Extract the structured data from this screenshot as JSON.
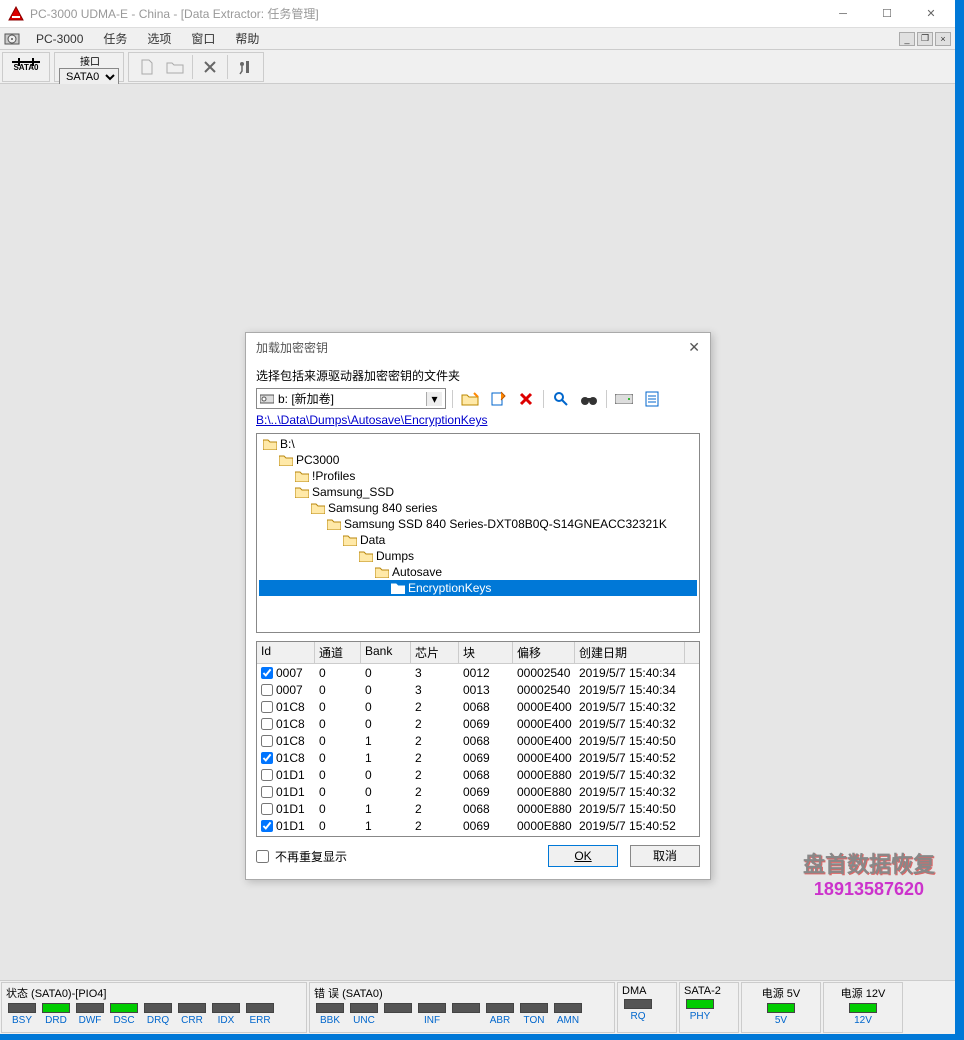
{
  "window": {
    "title": "PC-3000 UDMA-E - China - [Data Extractor: 任务管理]"
  },
  "menu": {
    "app": "PC-3000",
    "items": [
      "任务",
      "选项",
      "窗口",
      "帮助"
    ]
  },
  "toolbar": {
    "sata_label": "SATA0",
    "port_label": "接口",
    "port_value": "SATA0"
  },
  "dialog": {
    "title": "加载加密密钥",
    "instruction": "选择包括来源驱动器加密密钥的文件夹",
    "drive": "b: [新加卷]",
    "path": "B:\\..\\Data\\Dumps\\Autosave\\EncryptionKeys",
    "tree": [
      {
        "indent": 0,
        "label": "B:\\",
        "open": true
      },
      {
        "indent": 1,
        "label": "PC3000",
        "open": true
      },
      {
        "indent": 2,
        "label": "!Profiles",
        "open": false
      },
      {
        "indent": 2,
        "label": "Samsung_SSD",
        "open": true
      },
      {
        "indent": 3,
        "label": "Samsung 840 series",
        "open": true
      },
      {
        "indent": 4,
        "label": "Samsung SSD 840 Series-DXT08B0Q-S14GNEACC32321K",
        "open": true
      },
      {
        "indent": 5,
        "label": "Data",
        "open": true
      },
      {
        "indent": 6,
        "label": "Dumps",
        "open": true
      },
      {
        "indent": 7,
        "label": "Autosave",
        "open": true
      },
      {
        "indent": 8,
        "label": "EncryptionKeys",
        "open": true,
        "selected": true
      }
    ],
    "columns": [
      "Id",
      "通道",
      "Bank",
      "芯片",
      "块",
      "偏移",
      "创建日期"
    ],
    "rows": [
      {
        "checked": true,
        "id": "0007",
        "ch": "0",
        "bank": "0",
        "chip": "3",
        "block": "0012",
        "offset": "00002540",
        "date": "2019/5/7 15:40:34"
      },
      {
        "checked": false,
        "id": "0007",
        "ch": "0",
        "bank": "0",
        "chip": "3",
        "block": "0013",
        "offset": "00002540",
        "date": "2019/5/7 15:40:34"
      },
      {
        "checked": false,
        "id": "01C8",
        "ch": "0",
        "bank": "0",
        "chip": "2",
        "block": "0068",
        "offset": "0000E400",
        "date": "2019/5/7 15:40:32"
      },
      {
        "checked": false,
        "id": "01C8",
        "ch": "0",
        "bank": "0",
        "chip": "2",
        "block": "0069",
        "offset": "0000E400",
        "date": "2019/5/7 15:40:32"
      },
      {
        "checked": false,
        "id": "01C8",
        "ch": "0",
        "bank": "1",
        "chip": "2",
        "block": "0068",
        "offset": "0000E400",
        "date": "2019/5/7 15:40:50"
      },
      {
        "checked": true,
        "id": "01C8",
        "ch": "0",
        "bank": "1",
        "chip": "2",
        "block": "0069",
        "offset": "0000E400",
        "date": "2019/5/7 15:40:52"
      },
      {
        "checked": false,
        "id": "01D1",
        "ch": "0",
        "bank": "0",
        "chip": "2",
        "block": "0068",
        "offset": "0000E880",
        "date": "2019/5/7 15:40:32"
      },
      {
        "checked": false,
        "id": "01D1",
        "ch": "0",
        "bank": "0",
        "chip": "2",
        "block": "0069",
        "offset": "0000E880",
        "date": "2019/5/7 15:40:32"
      },
      {
        "checked": false,
        "id": "01D1",
        "ch": "0",
        "bank": "1",
        "chip": "2",
        "block": "0068",
        "offset": "0000E880",
        "date": "2019/5/7 15:40:50"
      },
      {
        "checked": true,
        "id": "01D1",
        "ch": "0",
        "bank": "1",
        "chip": "2",
        "block": "0069",
        "offset": "0000E880",
        "date": "2019/5/7 15:40:52"
      }
    ],
    "no_repeat": "不再重复显示",
    "ok": "OK",
    "cancel": "取消"
  },
  "watermark": {
    "line1": "盘首数据恢复",
    "line2": "18913587620"
  },
  "status": {
    "state_label": "状态 (SATA0)-[PIO4]",
    "state_leds": [
      {
        "label": "BSY",
        "on": false
      },
      {
        "label": "DRD",
        "on": true
      },
      {
        "label": "DWF",
        "on": false
      },
      {
        "label": "DSC",
        "on": true
      },
      {
        "label": "DRQ",
        "on": false
      },
      {
        "label": "CRR",
        "on": false
      },
      {
        "label": "IDX",
        "on": false
      },
      {
        "label": "ERR",
        "on": false
      }
    ],
    "error_label": "错 误 (SATA0)",
    "error_leds": [
      {
        "label": "BBK",
        "on": false
      },
      {
        "label": "UNC",
        "on": false
      },
      {
        "label": "",
        "on": false
      },
      {
        "label": "INF",
        "on": false
      },
      {
        "label": "",
        "on": false
      },
      {
        "label": "ABR",
        "on": false
      },
      {
        "label": "TON",
        "on": false
      },
      {
        "label": "AMN",
        "on": false
      }
    ],
    "dma_label": "DMA",
    "dma": [
      {
        "label": "RQ",
        "on": false
      }
    ],
    "sata_label": "SATA-2",
    "sata": [
      {
        "label": "PHY",
        "on": true
      }
    ],
    "pwr5_label": "电源 5V",
    "pwr5": [
      {
        "label": "5V",
        "on": true
      }
    ],
    "pwr12_label": "电源 12V",
    "pwr12": [
      {
        "label": "12V",
        "on": true
      }
    ]
  }
}
